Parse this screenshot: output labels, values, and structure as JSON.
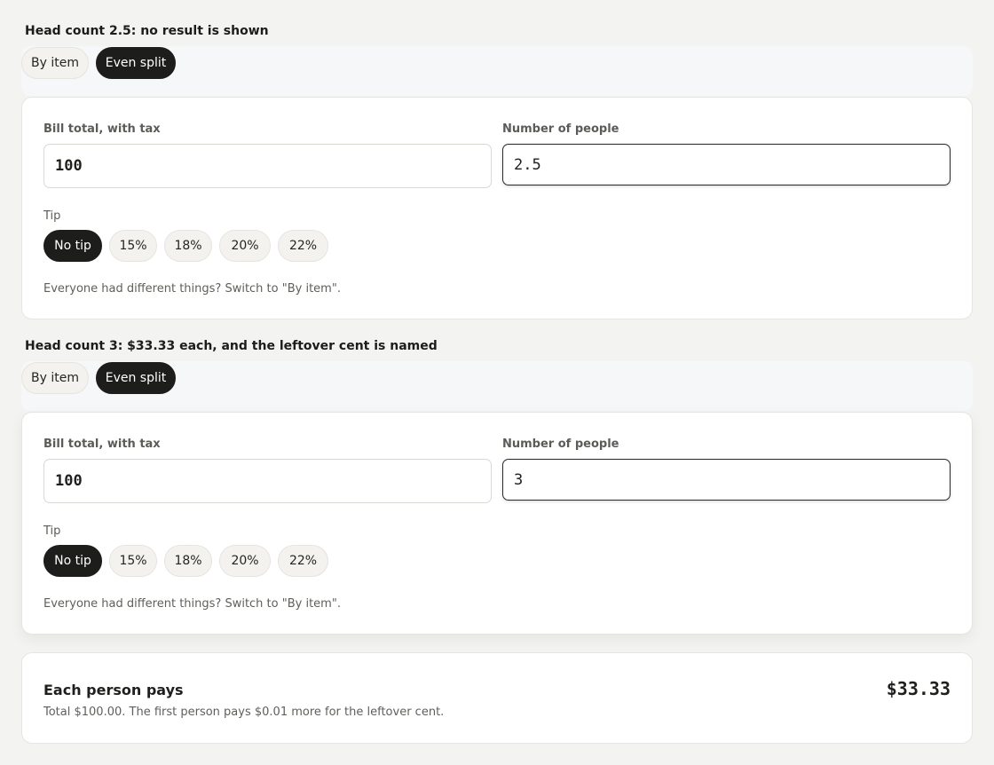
{
  "scenarios": [
    {
      "title": "Head count 2.5: no result is shown",
      "modes": {
        "by_item": "By item",
        "even_split": "Even split"
      },
      "bill_label": "Bill total, with tax",
      "bill_value": "100",
      "people_label": "Number of people",
      "people_value": "2.5",
      "tip_label": "Tip",
      "tips": [
        "No tip",
        "15%",
        "18%",
        "20%",
        "22%"
      ],
      "selected_tip": "No tip",
      "hint": "Everyone had different things? Switch to \"By item\"."
    },
    {
      "title": "Head count 3: $33.33 each, and the leftover cent is named",
      "modes": {
        "by_item": "By item",
        "even_split": "Even split"
      },
      "bill_label": "Bill total, with tax",
      "bill_value": "100",
      "people_label": "Number of people",
      "people_value": "3",
      "tip_label": "Tip",
      "tips": [
        "No tip",
        "15%",
        "18%",
        "20%",
        "22%"
      ],
      "selected_tip": "No tip",
      "hint": "Everyone had different things? Switch to \"By item\"."
    }
  ],
  "result": {
    "label": "Each person pays",
    "amount": "$33.33",
    "note": "Total $100.00. The first person pays $0.01 more for the leftover cent."
  },
  "colors": {
    "page_bg": "#f3f3f1",
    "selected": "#1d1d1b",
    "chip_bg": "#f3f2ee"
  }
}
